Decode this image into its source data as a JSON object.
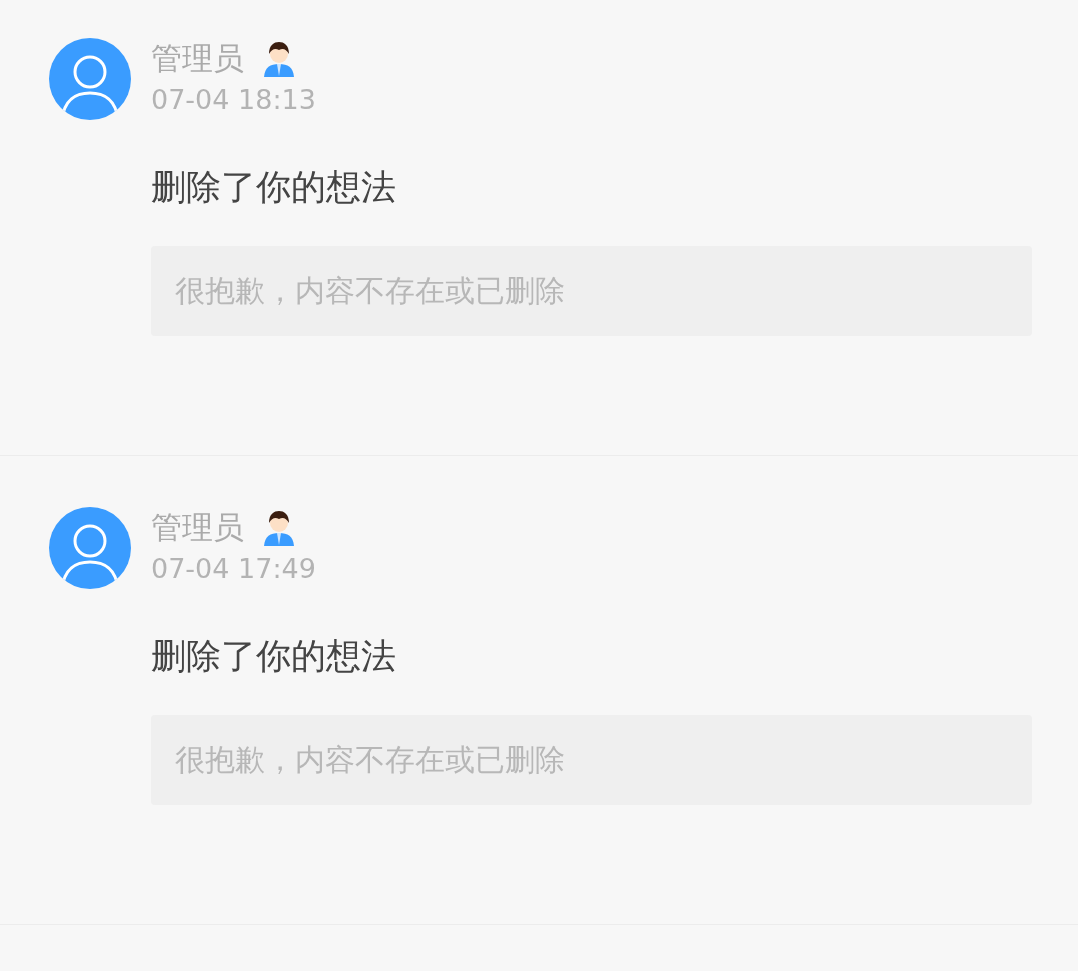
{
  "notifications": [
    {
      "name": "管理员",
      "admin": true,
      "time": "07-04 18:13",
      "message": "删除了你的想法",
      "quote": "很抱歉，内容不存在或已删除"
    },
    {
      "name": "管理员",
      "admin": true,
      "time": "07-04 17:49",
      "message": "删除了你的想法",
      "quote": "很抱歉，内容不存在或已删除"
    }
  ]
}
